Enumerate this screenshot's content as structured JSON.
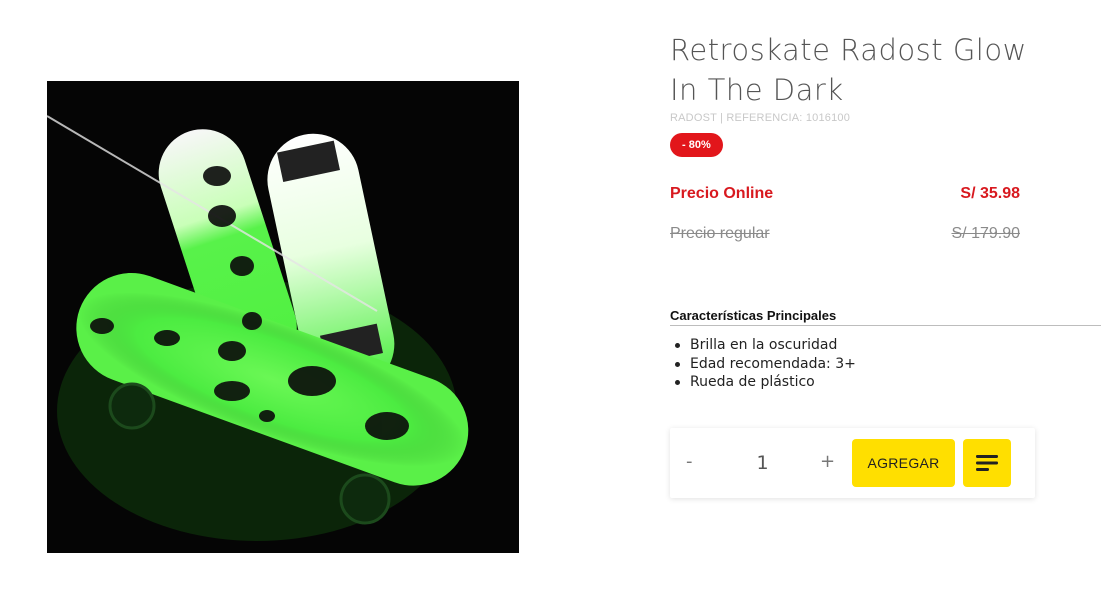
{
  "product": {
    "title": "Retroskate Radost Glow In The Dark",
    "meta": "RADOST | REFERENCIA: 1016100",
    "discount": "- 80%",
    "image_icon": "product-photo-skateboards"
  },
  "pricing": {
    "online_label": "Precio Online",
    "online_value": "S/ 35.98",
    "regular_label": "Precio regular",
    "regular_value": "S/ 179.90"
  },
  "features": {
    "title": "Características Principales",
    "items": [
      "Brilla en la oscuridad",
      "Edad recomendada: 3+",
      "Rueda de plástico"
    ]
  },
  "cart": {
    "minus": "-",
    "quantity": "1",
    "plus": "+",
    "add_label": "AGREGAR",
    "list_icon": "list-icon"
  },
  "colors": {
    "accent_yellow": "#ffdf00",
    "price_red": "#d8191f",
    "badge_red": "#e2161b"
  }
}
